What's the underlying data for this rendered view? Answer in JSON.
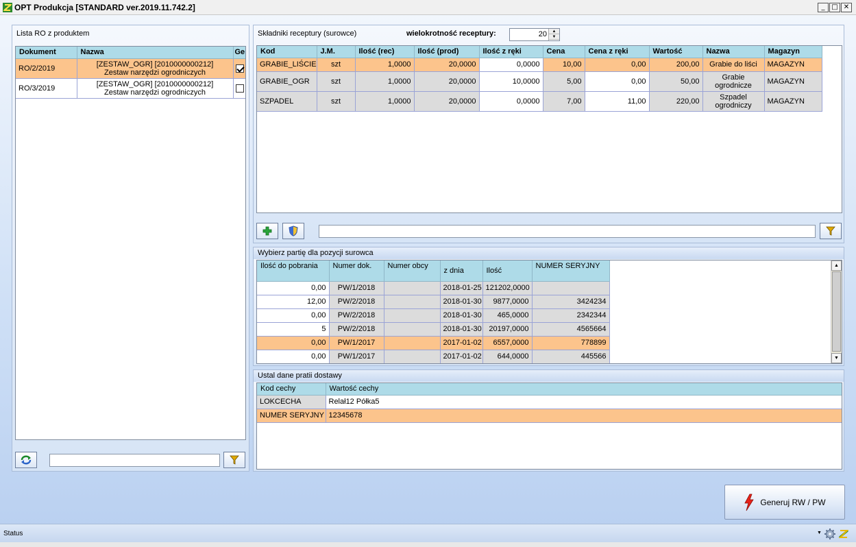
{
  "window": {
    "title": "OPT Produkcja [STANDARD ver.2019.11.742.2]",
    "buttons": [
      "_",
      "□",
      "✕"
    ]
  },
  "left_panel": {
    "title": "Lista RO z produktem",
    "columns": [
      "Dokument",
      "Nazwa",
      "Ge"
    ],
    "rows": [
      {
        "dokument": "RO/2/2019",
        "nazwa_line1": "[ZESTAW_OGR] [2010000000212]",
        "nazwa_line2": "Zestaw narzędzi ogrodniczych",
        "checked": true
      },
      {
        "dokument": "RO/3/2019",
        "nazwa_line1": "[ZESTAW_OGR] [2010000000212]",
        "nazwa_line2": "Zestaw narzędzi ogrodniczych",
        "checked": false
      }
    ],
    "filter_value": ""
  },
  "recipe_panel": {
    "title": "Składniki receptury (surowce)",
    "multiplicity_label": "wielokrotność receptury:",
    "multiplicity_value": "20",
    "columns": [
      "Kod",
      "J.M.",
      "Ilość (rec)",
      "Ilość (prod)",
      "Ilość z ręki",
      "Cena",
      "Cena z ręki",
      "Wartość",
      "Nazwa",
      "Magazyn"
    ],
    "rows": [
      [
        "GRABIE_LIŚCIE",
        "szt",
        "1,0000",
        "20,0000",
        "0,0000",
        "10,00",
        "0,00",
        "200,00",
        "Grabie do liści",
        "MAGAZYN"
      ],
      [
        "GRABIE_OGR",
        "szt",
        "1,0000",
        "20,0000",
        "10,0000",
        "5,00",
        "0,00",
        "50,00",
        "Grabie ogrodnicze",
        "MAGAZYN"
      ],
      [
        "SZPADEL",
        "szt",
        "1,0000",
        "20,0000",
        "0,0000",
        "7,00",
        "11,00",
        "220,00",
        "Szpadel ogrodniczy",
        "MAGAZYN"
      ]
    ],
    "filter_value": ""
  },
  "batch_panel": {
    "title": "Wybierz partię dla pozycji surowca",
    "columns": [
      "Ilość do pobrania",
      "Numer dok.",
      "Numer obcy",
      "z dnia",
      "Ilość",
      "NUMER SERYJNY"
    ],
    "rows": [
      [
        "0,00",
        "PW/1/2018",
        "",
        "2018-01-25",
        "121202,0000",
        ""
      ],
      [
        "12,00",
        "PW/2/2018",
        "",
        "2018-01-30",
        "9877,0000",
        "3424234"
      ],
      [
        "0,00",
        "PW/2/2018",
        "",
        "2018-01-30",
        "465,0000",
        "2342344"
      ],
      [
        "5",
        "PW/2/2018",
        "",
        "2018-01-30",
        "20197,0000",
        "4565664"
      ],
      [
        "0,00",
        "PW/1/2017",
        "",
        "2017-01-02",
        "6557,0000",
        "778899"
      ],
      [
        "0,00",
        "PW/1/2017",
        "",
        "2017-01-02",
        "644,0000",
        "445566"
      ]
    ]
  },
  "delivery_panel": {
    "title": "Ustal dane pratii dostawy",
    "columns": [
      "Kod cechy",
      "Wartość cechy"
    ],
    "rows": [
      [
        "LOKCECHA",
        "Relał12 Półka5"
      ],
      [
        "NUMER SERYJNY",
        "12345678"
      ]
    ]
  },
  "generate_button": "Generuj RW / PW",
  "status": "Status"
}
